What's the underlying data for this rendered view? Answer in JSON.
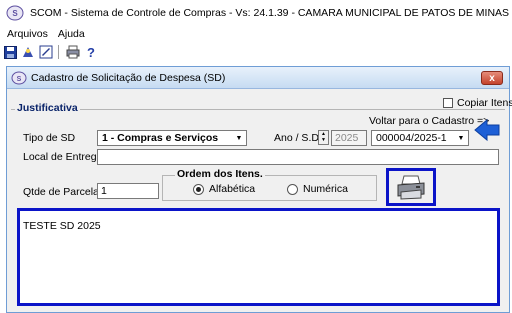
{
  "app": {
    "title": "SCOM - Sistema de Controle de Compras - Vs: 24.1.39 - CAMARA MUNICIPAL DE PATOS DE MINAS"
  },
  "menu": {
    "items": [
      "Arquivos",
      "Ajuda"
    ]
  },
  "toolbar": {
    "icons": [
      "save-icon",
      "wizard-icon",
      "edit-icon",
      "print-icon",
      "help-icon"
    ]
  },
  "window": {
    "title": "Cadastro de Solicitação de Despesa (SD)",
    "close_label": "x"
  },
  "form": {
    "copiar_itens_label": "Copiar Itens",
    "copiar_itens_checked": false,
    "justificativa_label": "Justificativa",
    "voltar_label": "Voltar para o Cadastro =>",
    "tipo_sd_label": "Tipo de SD",
    "tipo_sd_value": "1 - Compras e Serviços",
    "ano_sd_label": "Ano / S.D.",
    "ano_value": "2025",
    "sd_select_value": "000004/2025-1",
    "local_entrega_label": "Local de Entrega",
    "local_entrega_value": "",
    "ordem_label": "Ordem dos Itens.",
    "radio_alfabetica": "Alfabética",
    "radio_numerica": "Numérica",
    "radio_selected": "Alfabética",
    "qtde_parcelas_label": "Qtde de Parcelas",
    "qtde_parcelas_value": "1",
    "memo_text": "TESTE SD 2025"
  },
  "colors": {
    "highlight_border": "#0b14c8",
    "arrow_blue": "#1d5fd6",
    "titlebar": "#c6dbf2"
  }
}
